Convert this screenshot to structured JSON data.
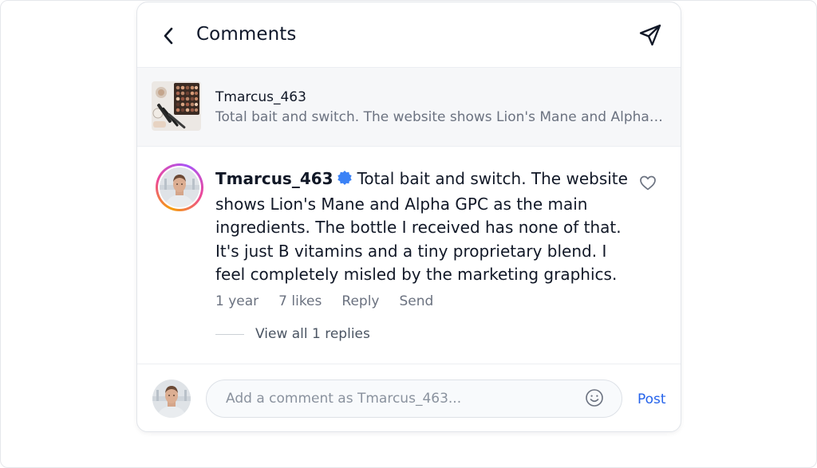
{
  "header": {
    "title": "Comments",
    "back_icon": "chevron-left-icon",
    "send_icon": "send-icon"
  },
  "post": {
    "username": "Tmarcus_463",
    "snippet": "Total bait and switch. The website shows Lion's Mane and Alpha GPC as the main ingredients. The bottle I received has none of that."
  },
  "comment": {
    "username": "Tmarcus_463",
    "verified": true,
    "text": "Total bait and switch. The website shows Lion's Mane and Alpha GPC as the main ingredients. The bottle I received has none of that. It's just B vitamins and a tiny proprietary blend. I feel completely misled by the marketing graphics.",
    "time": "1 year",
    "likes": "7 likes",
    "reply_label": "Reply",
    "send_label": "Send",
    "view_replies": "View all 1 replies"
  },
  "composer": {
    "placeholder": "Add a comment as Tmarcus_463...",
    "value": "",
    "post_label": "Post"
  },
  "colors": {
    "accent": "#2563eb",
    "verified": "#3b82f6",
    "muted_text": "#6b7280"
  }
}
